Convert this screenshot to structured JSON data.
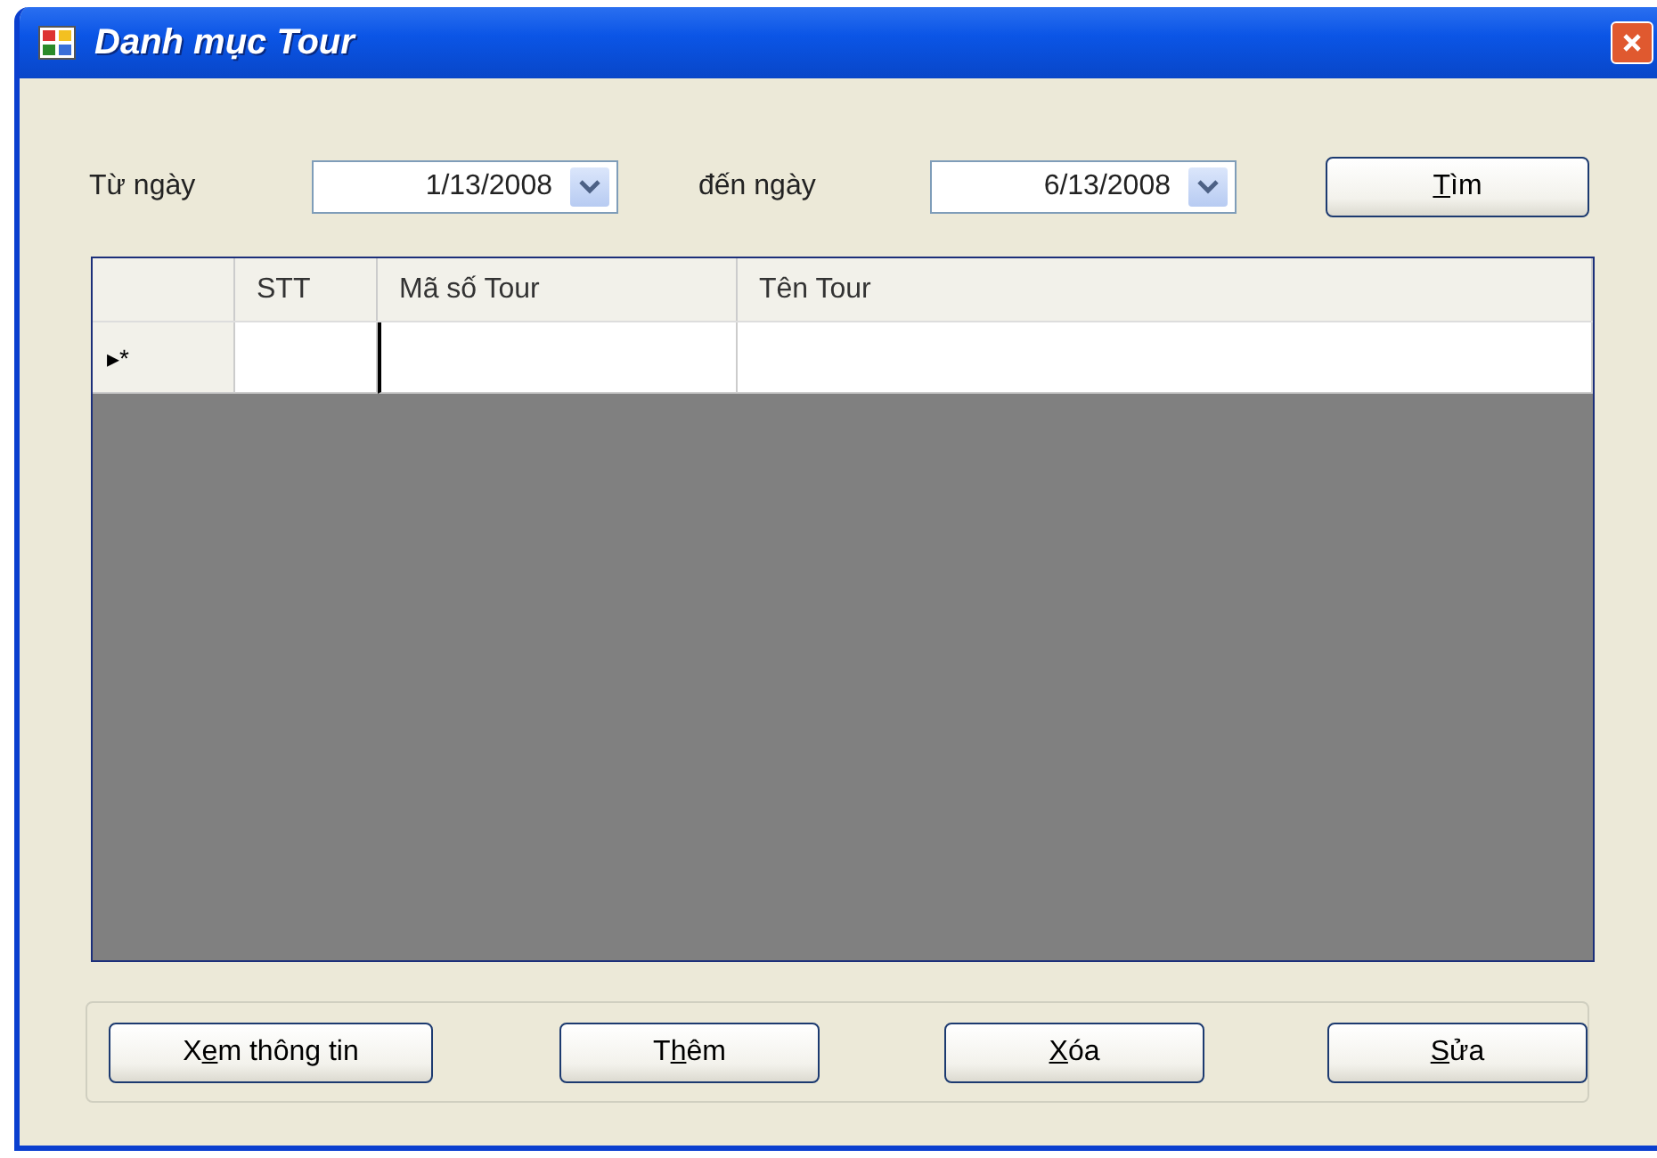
{
  "window": {
    "title": "Danh mục Tour"
  },
  "filter": {
    "from_label": "Từ ngày",
    "from_date": "1/13/2008",
    "to_label": "đến ngày",
    "to_date": "6/13/2008",
    "search_button": {
      "access_key": "T",
      "after": "ìm"
    }
  },
  "grid": {
    "columns": [
      "STT",
      "Mã số Tour",
      "Tên Tour"
    ],
    "new_row_marker": "▸*"
  },
  "buttons": [
    {
      "before": "X",
      "access_key": "e",
      "after": "m thông tin"
    },
    {
      "before": "T",
      "access_key": "h",
      "after": "êm"
    },
    {
      "access_key": "X",
      "after": "óa"
    },
    {
      "access_key": "S",
      "after": "ửa"
    }
  ]
}
